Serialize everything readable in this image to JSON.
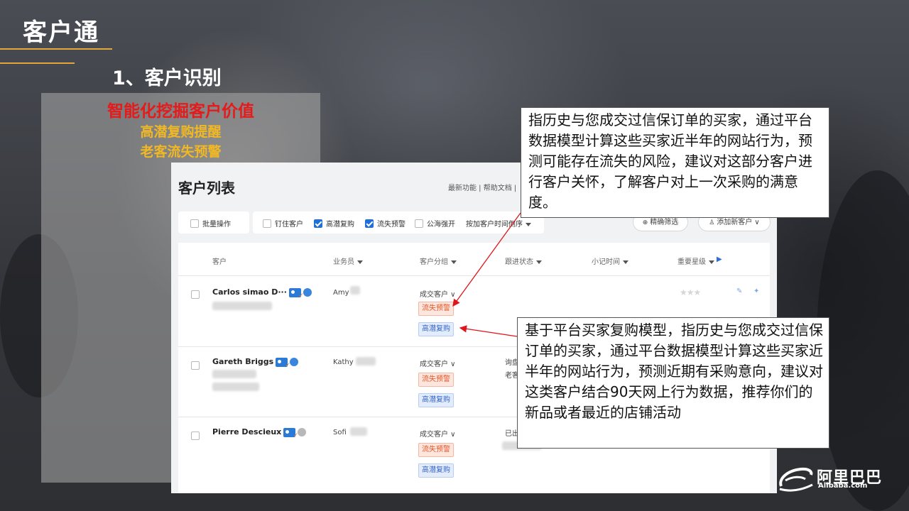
{
  "slide": {
    "title": "客户通",
    "subtitle": "1、客户识别",
    "features": [
      "智能化挖掘客户价值",
      "高潜复购提醒",
      "老客流失预警"
    ],
    "colors": {
      "accent_line": "#e3a63a",
      "feature_red": "#e51b1b",
      "feature_yellow": "#f1b824",
      "arrow": "#e0141b"
    }
  },
  "app": {
    "page_title": "客户列表",
    "header_links": "最新功能 | 帮助文档 |",
    "toolbar": {
      "bulk_label": "批量操作",
      "filters": [
        {
          "label": "钉住客户",
          "checked": false
        },
        {
          "label": "高潜复购",
          "checked": true
        },
        {
          "label": "流失预警",
          "checked": true
        },
        {
          "label": "公海强开",
          "checked": false
        }
      ],
      "sort_label": "按加客户时间倒序",
      "precise_filter": "精确筛选",
      "add_customer": "添加新客户"
    },
    "columns": [
      "客户",
      "业务员",
      "客户分组",
      "跟进状态",
      "小记时间",
      "重要星级"
    ],
    "rows": [
      {
        "name": "Carlos simao D···",
        "agent": "Amy",
        "group": "成交客户",
        "tags": [
          "流失预警",
          "高潜复购"
        ],
        "follow": "",
        "globe": "blue",
        "stars": "★★★"
      },
      {
        "name": "Gareth Briggs",
        "agent": "Kathy",
        "group": "成交客户",
        "tags": [
          "流失预警",
          "高潜复购"
        ],
        "follow": "询盘\n老客",
        "globe": "blue",
        "stars": ""
      },
      {
        "name": "Pierre Descieux",
        "agent": "Sofi",
        "group": "成交客户",
        "tags": [
          "流失预警",
          "高潜复购"
        ],
        "follow": "已出",
        "globe": "gray",
        "stars": "★★"
      }
    ]
  },
  "callouts": {
    "top": "指历史与您成交过信保订单的买家，通过平台数据模型计算这些买家近半年的网站行为，预测可能存在流失的风险，建议对这部分客户进行客户关怀，了解客户对上一次采购的满意度。",
    "bottom": "基于平台买家复购模型，指历史与您成交过信保订单的买家，通过平台数据模型计算这些买家近半年的网站行为，预测近期有采购意向，建议对这类客户结合90天网上行为数据，推荐你们的新品或者最近的店铺活动"
  },
  "logo": {
    "cn": "阿里巴巴",
    "en": "Alibaba.com"
  }
}
